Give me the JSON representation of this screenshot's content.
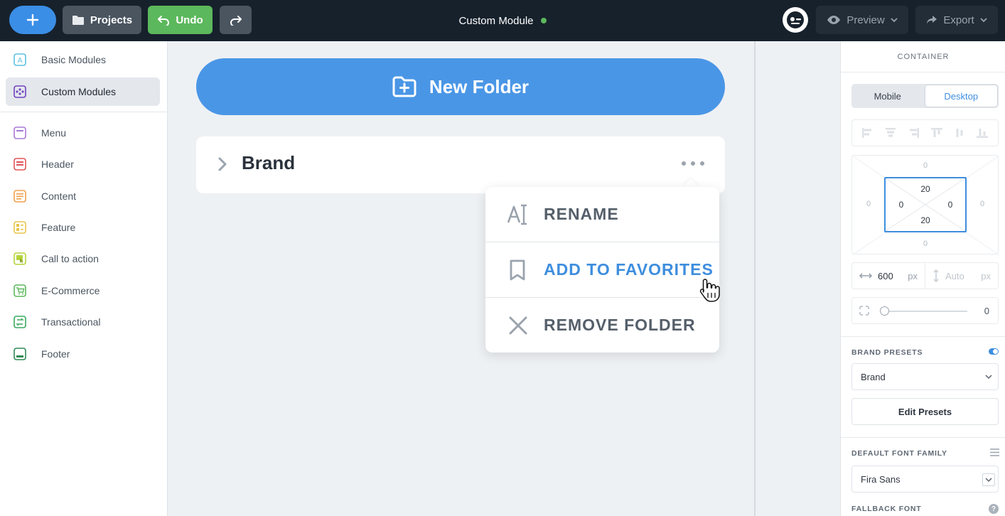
{
  "topbar": {
    "projects_label": "Projects",
    "undo_label": "Undo",
    "title": "Custom Module",
    "preview_label": "Preview",
    "export_label": "Export"
  },
  "sidebar": {
    "items": [
      {
        "label": "Basic Modules",
        "color": "#5bc0de"
      },
      {
        "label": "Custom Modules",
        "color": "#6f42c1"
      },
      {
        "label": "Menu",
        "color": "#a97ad8"
      },
      {
        "label": "Header",
        "color": "#e0555b"
      },
      {
        "label": "Content",
        "color": "#f0a04b"
      },
      {
        "label": "Feature",
        "color": "#e8c54a"
      },
      {
        "label": "Call to action",
        "color": "#b5d33a"
      },
      {
        "label": "E-Commerce",
        "color": "#5cb85c"
      },
      {
        "label": "Transactional",
        "color": "#3aaa5e"
      },
      {
        "label": "Footer",
        "color": "#2e8b57"
      }
    ]
  },
  "canvas": {
    "new_folder_label": "New Folder",
    "folder_name": "Brand",
    "menu": {
      "rename": "RENAME",
      "favorites": "ADD TO FAVORITES",
      "remove": "REMOVE FOLDER"
    }
  },
  "panel": {
    "title": "CONTAINER",
    "tabs": {
      "mobile": "Mobile",
      "desktop": "Desktop"
    },
    "box": {
      "margin_top": "0",
      "margin_right": "0",
      "margin_bottom": "0",
      "margin_left": "0",
      "padding_top": "20",
      "padding_right": "0",
      "padding_bottom": "20",
      "padding_left": "0"
    },
    "width_value": "600",
    "width_unit": "px",
    "height_placeholder": "Auto",
    "height_unit": "px",
    "radius_value": "0",
    "brand_presets_label": "BRAND PRESETS",
    "brand_preset_value": "Brand",
    "edit_presets_label": "Edit Presets",
    "font_family_label": "DEFAULT FONT FAMILY",
    "font_family_value": "Fira Sans",
    "fallback_label": "FALLBACK FONT",
    "help_glyph": "?"
  },
  "colors": {
    "accent": "#3e8ede",
    "topbar": "#16212c",
    "success": "#5cb85c"
  }
}
